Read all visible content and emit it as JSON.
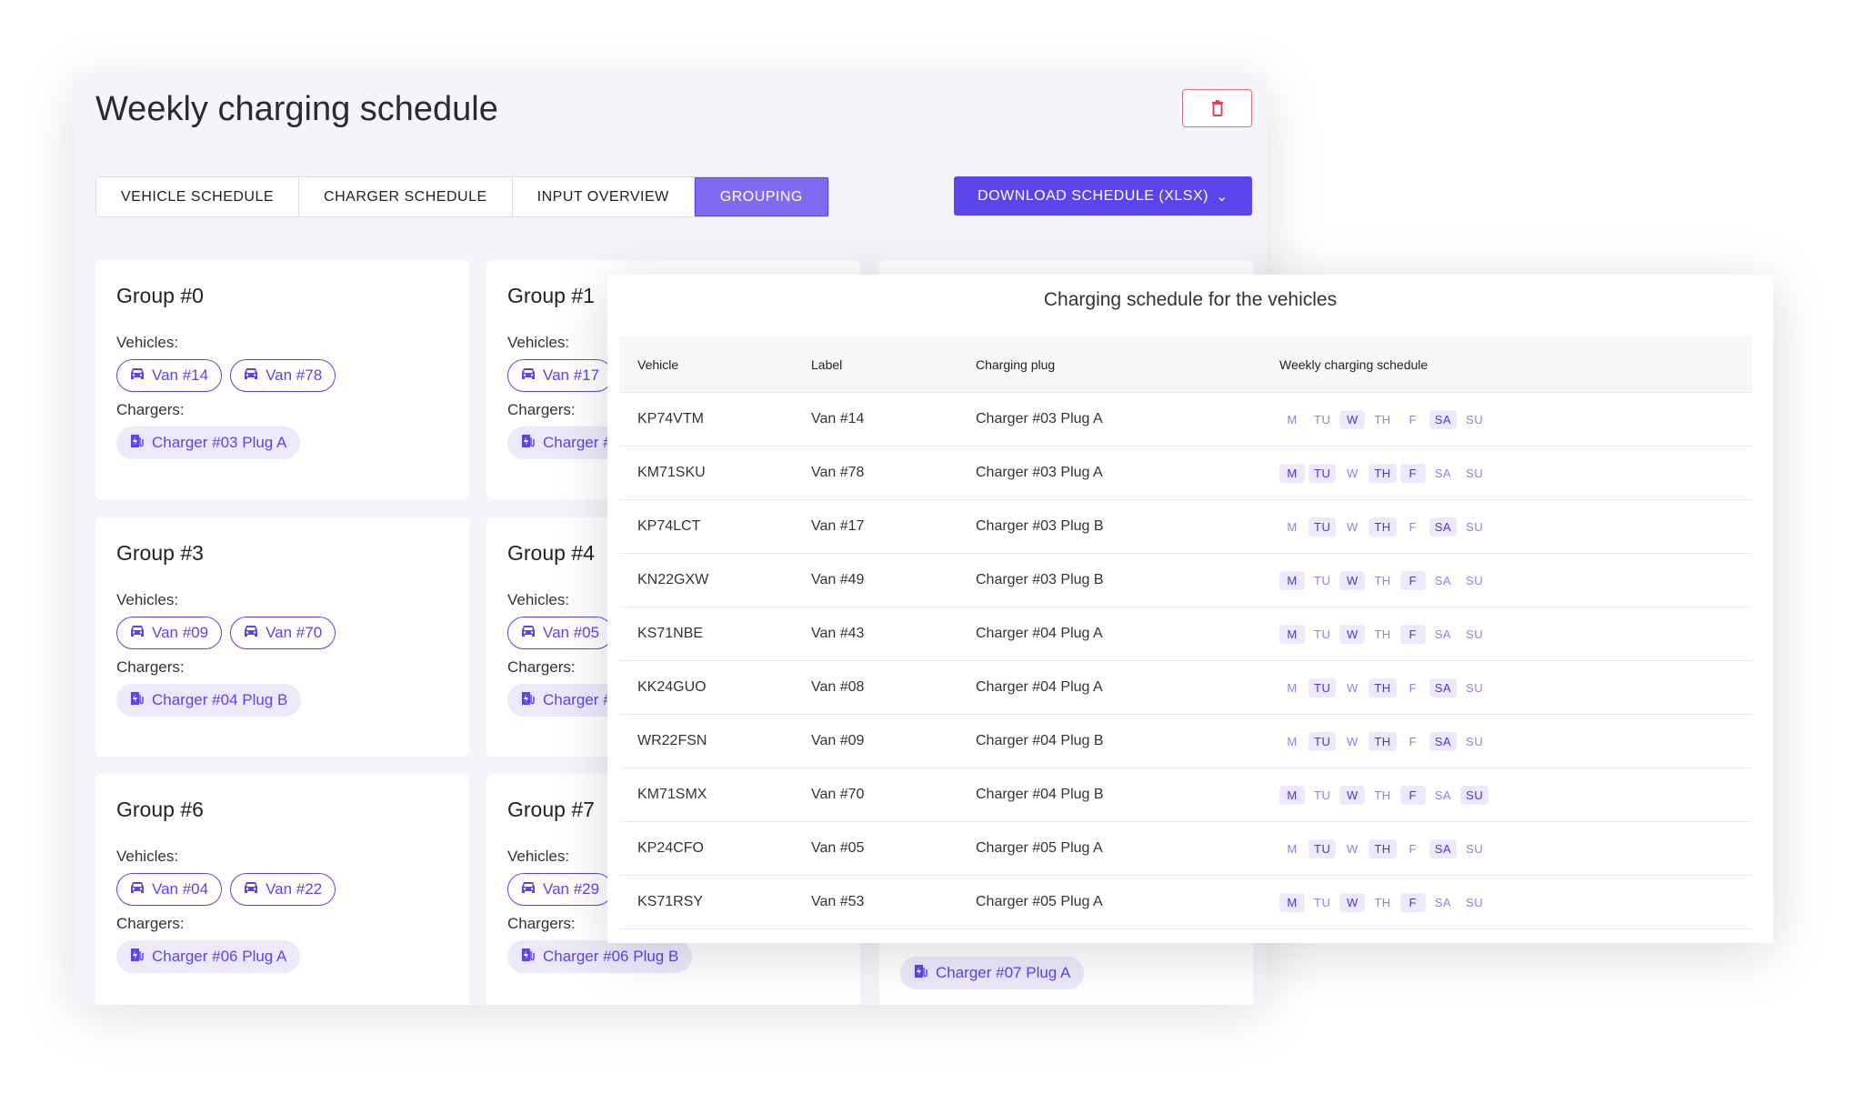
{
  "title": "Weekly charging schedule",
  "tabs": [
    "VEHICLE SCHEDULE",
    "CHARGER SCHEDULE",
    "INPUT OVERVIEW",
    "GROUPING"
  ],
  "active_tab": "GROUPING",
  "download_label": "DOWNLOAD SCHEDULE (XLSX)",
  "vehicles_label": "Vehicles:",
  "chargers_label": "Chargers:",
  "accent": "#5b45ea",
  "groups": [
    {
      "title": "Group #0",
      "vehicles": [
        "Van #14",
        "Van #78"
      ],
      "chargers": [
        "Charger #03 Plug A"
      ]
    },
    {
      "title": "Group #1",
      "vehicles": [
        "Van #17"
      ],
      "chargers": [
        "Charger #"
      ]
    },
    {
      "title": "",
      "vehicles": [],
      "chargers": []
    },
    {
      "title": "Group #3",
      "vehicles": [
        "Van #09",
        "Van #70"
      ],
      "chargers": [
        "Charger #04 Plug B"
      ]
    },
    {
      "title": "Group #4",
      "vehicles": [
        "Van #05"
      ],
      "chargers": [
        "Charger #"
      ]
    },
    {
      "title": "",
      "vehicles": [],
      "chargers": []
    },
    {
      "title": "Group #6",
      "vehicles": [
        "Van #04",
        "Van #22"
      ],
      "chargers": [
        "Charger #06 Plug A"
      ]
    },
    {
      "title": "Group #7",
      "vehicles": [
        "Van #29"
      ],
      "chargers": [
        "Charger #06 Plug B"
      ]
    },
    {
      "title": "",
      "vehicles": [],
      "chargers": [
        "Charger #07 Plug A"
      ]
    }
  ],
  "schedule": {
    "title": "Charging schedule for the vehicles",
    "headers": [
      "Vehicle",
      "Label",
      "Charging plug",
      "Weekly charging schedule"
    ],
    "days": [
      "M",
      "TU",
      "W",
      "TH",
      "F",
      "SA",
      "SU"
    ],
    "rows": [
      {
        "vehicle": "KP74VTM",
        "label": "Van #14",
        "plug": "Charger #03 Plug A",
        "on": [
          "W",
          "SA"
        ]
      },
      {
        "vehicle": "KM71SKU",
        "label": "Van #78",
        "plug": "Charger #03 Plug A",
        "on": [
          "M",
          "TU",
          "TH",
          "F"
        ]
      },
      {
        "vehicle": "KP74LCT",
        "label": "Van #17",
        "plug": "Charger #03 Plug B",
        "on": [
          "TU",
          "TH",
          "SA"
        ]
      },
      {
        "vehicle": "KN22GXW",
        "label": "Van #49",
        "plug": "Charger #03 Plug B",
        "on": [
          "M",
          "W",
          "F"
        ]
      },
      {
        "vehicle": "KS71NBE",
        "label": "Van #43",
        "plug": "Charger #04 Plug A",
        "on": [
          "M",
          "W",
          "F"
        ]
      },
      {
        "vehicle": "KK24GUO",
        "label": "Van #08",
        "plug": "Charger #04 Plug A",
        "on": [
          "TU",
          "TH",
          "SA"
        ]
      },
      {
        "vehicle": "WR22FSN",
        "label": "Van #09",
        "plug": "Charger #04 Plug B",
        "on": [
          "TU",
          "TH",
          "SA"
        ]
      },
      {
        "vehicle": "KM71SMX",
        "label": "Van #70",
        "plug": "Charger #04 Plug B",
        "on": [
          "M",
          "W",
          "F",
          "SU"
        ]
      },
      {
        "vehicle": "KP24CFO",
        "label": "Van #05",
        "plug": "Charger #05 Plug A",
        "on": [
          "TU",
          "TH",
          "SA"
        ]
      },
      {
        "vehicle": "KS71RSY",
        "label": "Van #53",
        "plug": "Charger #05 Plug A",
        "on": [
          "M",
          "W",
          "F"
        ]
      }
    ]
  }
}
